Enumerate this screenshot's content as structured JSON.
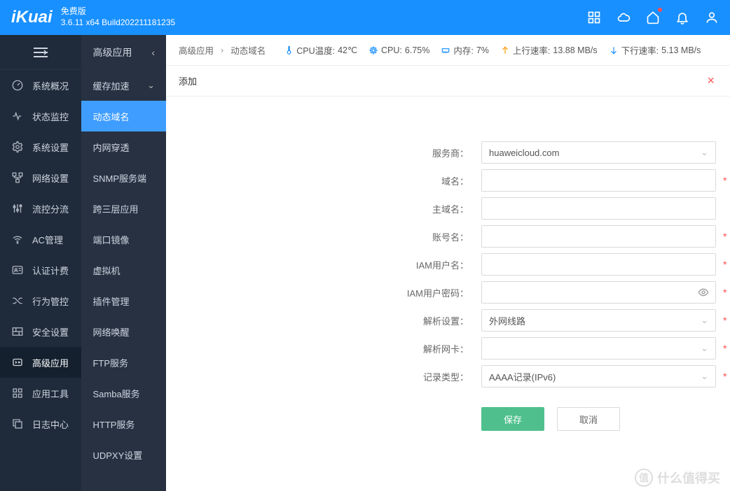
{
  "header": {
    "logo": "iKuai",
    "edition": "免费版",
    "version": "3.6.11 x64 Build202211181235"
  },
  "statusbar": {
    "crumb1": "高级应用",
    "crumb2": "动态域名",
    "cpu_temp_label": "CPU温度: ",
    "cpu_temp_value": "42℃",
    "cpu_label": "CPU: ",
    "cpu_value": "6.75%",
    "mem_label": "内存: ",
    "mem_value": "7%",
    "up_label": "上行速率: ",
    "up_value": "13.88 MB/s",
    "down_label": "下行速率: ",
    "down_value": "5.13 MB/s"
  },
  "page_title": "添加",
  "sidebar_main": {
    "items": [
      {
        "label": "系统概况"
      },
      {
        "label": "状态监控"
      },
      {
        "label": "系统设置"
      },
      {
        "label": "网络设置"
      },
      {
        "label": "流控分流"
      },
      {
        "label": "AC管理"
      },
      {
        "label": "认证计费"
      },
      {
        "label": "行为管控"
      },
      {
        "label": "安全设置"
      },
      {
        "label": "高级应用"
      },
      {
        "label": "应用工具"
      },
      {
        "label": "日志中心"
      }
    ]
  },
  "sidebar_sub": {
    "header": "高级应用",
    "group": "缓存加速",
    "items": [
      {
        "label": "动态域名"
      },
      {
        "label": "内网穿透"
      },
      {
        "label": "SNMP服务端"
      },
      {
        "label": "跨三层应用"
      },
      {
        "label": "端口镜像"
      },
      {
        "label": "虚拟机"
      },
      {
        "label": "插件管理"
      },
      {
        "label": "网络唤醒"
      },
      {
        "label": "FTP服务"
      },
      {
        "label": "Samba服务"
      },
      {
        "label": "HTTP服务"
      },
      {
        "label": "UDPXY设置"
      }
    ]
  },
  "form": {
    "provider_label": "服务商：",
    "provider_value": "huaweicloud.com",
    "domain_label": "域名：",
    "mainhost_label": "主域名：",
    "account_label": "账号名：",
    "iamuser_label": "IAM用户名：",
    "iampass_label": "IAM用户密码：",
    "resolve_cfg_label": "解析设置：",
    "resolve_cfg_value": "外网线路",
    "resolve_nic_label": "解析网卡：",
    "record_type_label": "记录类型：",
    "record_type_value": "AAAA记录(IPv6)",
    "save": "保存",
    "cancel": "取消"
  },
  "watermark": "什么值得买"
}
